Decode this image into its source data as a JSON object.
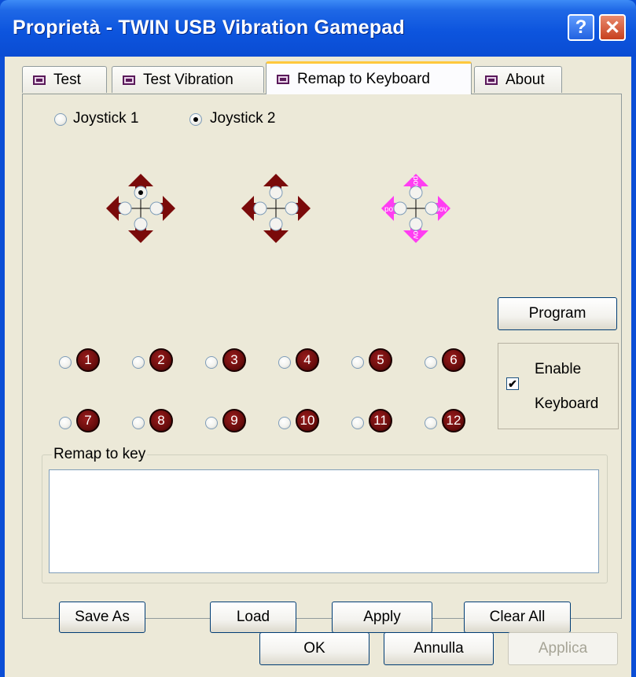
{
  "window": {
    "title": "Proprietà - TWIN USB Vibration Gamepad",
    "help_label": "?",
    "close_label": "✕"
  },
  "tabs": [
    {
      "label": "Test",
      "active": false
    },
    {
      "label": "Test Vibration",
      "active": false
    },
    {
      "label": "Remap to Keyboard",
      "active": true
    },
    {
      "label": "About",
      "active": false
    }
  ],
  "joystick": {
    "option1": "Joystick 1",
    "option2": "Joystick 2",
    "selected": "Joystick 2"
  },
  "dpads": [
    {
      "name": "left-stick",
      "color": "#7a0a0a",
      "arrow_label": "",
      "selected_direction": "up"
    },
    {
      "name": "right-stick",
      "color": "#7a0a0a",
      "arrow_label": "",
      "selected_direction": ""
    },
    {
      "name": "pov",
      "color": "#ff3df2",
      "arrow_label": "pov",
      "selected_direction": ""
    }
  ],
  "buttons_row1": [
    "1",
    "2",
    "3",
    "4",
    "5",
    "6"
  ],
  "buttons_row2": [
    "7",
    "8",
    "9",
    "10",
    "11",
    "12"
  ],
  "program_label": "Program",
  "enable_keyboard": {
    "line1": "Enable",
    "line2": "Keyboard",
    "checked": true,
    "check_mark": "✔"
  },
  "remap": {
    "legend": "Remap to key",
    "value": ""
  },
  "panel_buttons": {
    "save_as": "Save As",
    "load": "Load",
    "apply": "Apply",
    "clear_all": "Clear All"
  },
  "dialog_buttons": {
    "ok": "OK",
    "cancel": "Annulla",
    "apply": "Applica"
  }
}
